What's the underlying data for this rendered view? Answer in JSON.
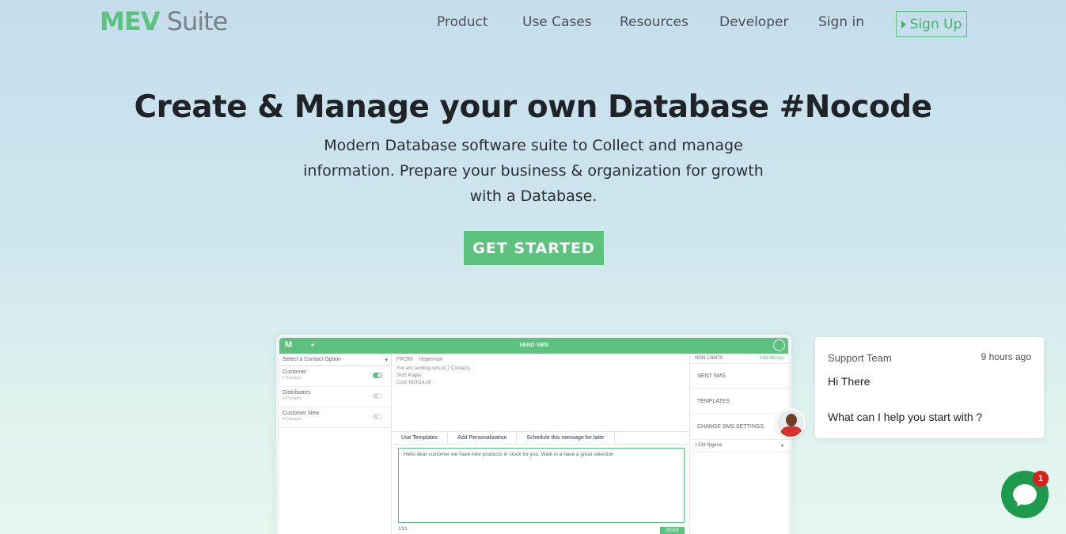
{
  "header": {
    "logo_mev": "MEV",
    "logo_suite": "Suite",
    "nav": [
      "Product",
      "Use Cases",
      "Resources",
      "Developer",
      "Sign in"
    ],
    "signup_label": "Sign Up"
  },
  "hero": {
    "title": "Create & Manage your own Database #Nocode",
    "subtitle": "Modern Database software suite to Collect and manage information. Prepare your business & organization for growth with a Database.",
    "cta_label": "GET STARTED"
  },
  "mockup": {
    "topbar_logo": "M",
    "topbar_title": "SEND SMS",
    "select_label": "Select a Contact Option",
    "contacts": [
      {
        "name": "Customer",
        "sub": "7 Contacts",
        "on": true
      },
      {
        "name": "Distributors",
        "sub": "2 Contacts",
        "on": false
      },
      {
        "name": "Customer New",
        "sub": "0 Contacts",
        "on": false
      }
    ],
    "from_label": "FROM",
    "from_value": "Hopeman",
    "info_line1": "You are sending sms to 7 Contacts.",
    "info_line2": "SMS Pages:",
    "info_line3": "Cost: NGN14.00",
    "toolbar": [
      "Use Templates",
      "Add Personalization",
      "Schedule this message for later"
    ],
    "message": "Hello dear customer we have new products in stock for you, Walk in a have a great selection",
    "count": "1/91",
    "send_label": "SEND",
    "balance": "NGN 128470",
    "add_money": "Add Money",
    "right_nav": [
      "SENT SMS",
      "TEMPLATES",
      "CHANGE SMS SETTINGS"
    ],
    "country": "+234 Nigeria"
  },
  "chat": {
    "team": "Support Team",
    "time": "9 hours ago",
    "greeting": "Hi There",
    "question": "What can I help you start with ?",
    "badge_count": "1"
  },
  "colors": {
    "brand_green": "#5ec27f",
    "chat_green": "#1e9a4d",
    "badge_red": "#d6231d"
  }
}
